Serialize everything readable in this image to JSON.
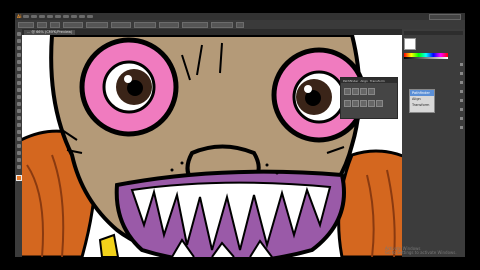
{
  "app": {
    "menu_logo": "Ai",
    "document_tab": "... @ 66% (CMYK/Preview)"
  },
  "colors": {
    "skin": "#b49a78",
    "eye_pink": "#f07bbf",
    "iris": "#3a2418",
    "ear_orange": "#d4671f",
    "mouth_purple": "#9a5aa8",
    "teeth": "#ffffff",
    "accent_yellow": "#f2d21a"
  },
  "float_panel": {
    "tabs": [
      "Pathfinder",
      "Align",
      "Transform"
    ]
  },
  "flyout": {
    "items": [
      "Pathfinder",
      "Align",
      "Transform"
    ]
  },
  "watermark": {
    "line1": "Activate Windows",
    "line2": "Go to Settings to activate Windows."
  }
}
